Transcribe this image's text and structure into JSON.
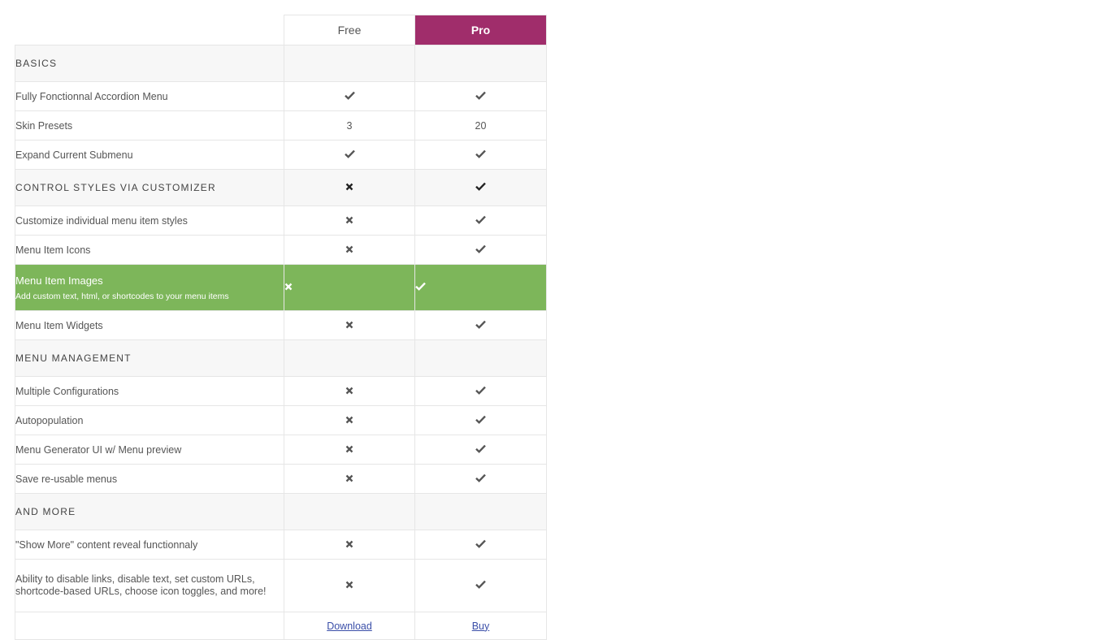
{
  "colors": {
    "pro": "#a02d6b",
    "highlight": "#7db65a",
    "section_bg": "#f7f7f7"
  },
  "header": {
    "free": "Free",
    "pro": "Pro"
  },
  "rows": [
    {
      "kind": "section",
      "label": "BASICS",
      "free": null,
      "pro": null
    },
    {
      "kind": "feature",
      "label": "Fully Fonctionnal Accordion Menu",
      "free": "check-icon",
      "pro": "check-icon"
    },
    {
      "kind": "feature",
      "label": "Skin Presets",
      "free": "3",
      "pro": "20"
    },
    {
      "kind": "feature",
      "label": "Expand Current Submenu",
      "free": "check-icon",
      "pro": "check-icon"
    },
    {
      "kind": "section",
      "label": "CONTROL STYLES VIA CUSTOMIZER",
      "free": "cross-icon",
      "pro": "check-icon"
    },
    {
      "kind": "feature",
      "label": "Customize individual menu item styles",
      "free": "cross-icon",
      "pro": "check-icon"
    },
    {
      "kind": "feature",
      "label": "Menu Item Icons",
      "free": "cross-icon",
      "pro": "check-icon"
    },
    {
      "kind": "highlight",
      "label": "Menu Item Images",
      "sub": "Add custom text, html, or shortcodes to your menu items",
      "free": "cross-icon",
      "pro": "check-icon"
    },
    {
      "kind": "feature",
      "label": "Menu Item Widgets",
      "free": "cross-icon",
      "pro": "check-icon"
    },
    {
      "kind": "section",
      "label": "MENU MANAGEMENT",
      "free": null,
      "pro": null
    },
    {
      "kind": "feature",
      "label": "Multiple Configurations",
      "free": "cross-icon",
      "pro": "check-icon"
    },
    {
      "kind": "feature",
      "label": "Autopopulation",
      "free": "cross-icon",
      "pro": "check-icon"
    },
    {
      "kind": "feature",
      "label": "Menu Generator UI w/ Menu preview",
      "free": "cross-icon",
      "pro": "check-icon"
    },
    {
      "kind": "feature",
      "label": "Save re-usable menus",
      "free": "cross-icon",
      "pro": "check-icon"
    },
    {
      "kind": "section",
      "label": "AND MORE",
      "free": null,
      "pro": null
    },
    {
      "kind": "feature",
      "label": "\"Show More\" content reveal functionnaly",
      "free": "cross-icon",
      "pro": "check-icon"
    },
    {
      "kind": "tall",
      "label": "Ability to disable links, disable text, set custom URLs, shortcode-based URLs, choose icon toggles, and more!",
      "free": "cross-icon",
      "pro": "check-icon"
    }
  ],
  "footer": {
    "free_link": "Download",
    "pro_link": "Buy"
  }
}
